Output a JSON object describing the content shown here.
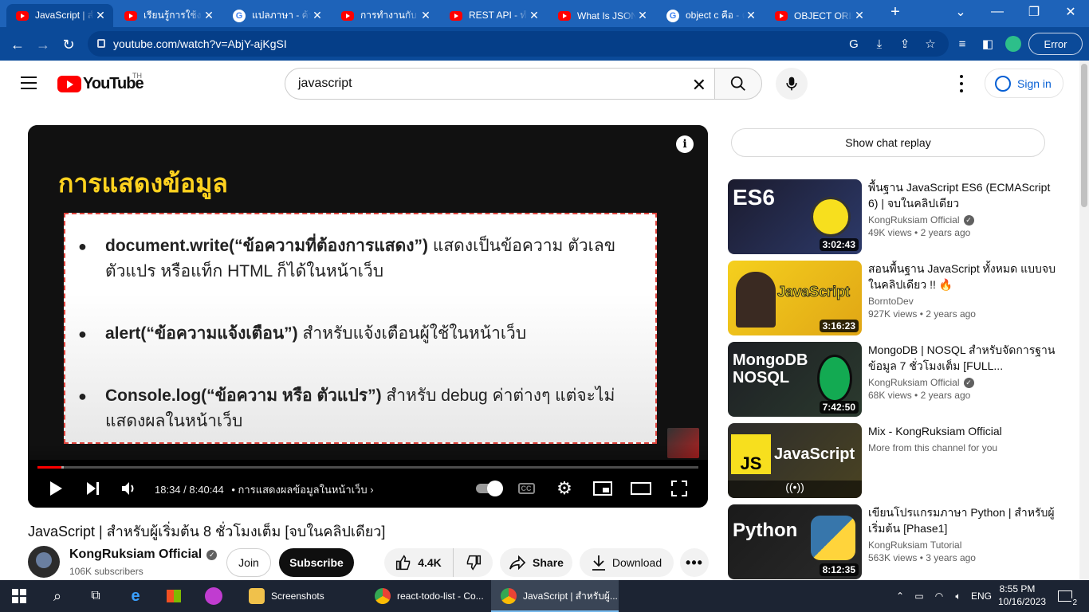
{
  "browser": {
    "tabs": [
      {
        "title": "JavaScript | สำหรับผู้เริ่มต้น",
        "favicon": "youtube-icon",
        "active": true
      },
      {
        "title": "เรียนรู้การใช้งาน",
        "favicon": "youtube-icon",
        "active": false
      },
      {
        "title": "แปลภาษา - ค้นหา",
        "favicon": "google-icon",
        "active": false
      },
      {
        "title": "การทำงานกับ JSON",
        "favicon": "youtube-icon",
        "active": false
      },
      {
        "title": "REST API - ทำ",
        "favicon": "youtube-icon",
        "active": false
      },
      {
        "title": "What Is JSON",
        "favicon": "youtube-icon",
        "active": false
      },
      {
        "title": "object c คือ - ค้นหา",
        "favicon": "google-icon",
        "active": false
      },
      {
        "title": "OBJECT ORIENTED",
        "favicon": "youtube-icon",
        "active": false
      }
    ],
    "new_tab": "+",
    "url": "youtube.com/watch?v=AbjY-ajKgSI",
    "error_button": "Error",
    "accent": "#1e63b9"
  },
  "youtube": {
    "logo_text": "YouTube",
    "country_code": "TH",
    "search_value": "javascript",
    "sign_in": "Sign in"
  },
  "player": {
    "slide_title": "การแสดงข้อมูล",
    "bullets": [
      {
        "code": "document.write(“ข้อความที่ต้องการแสดง”)",
        "text": " แสดงเป็นข้อความ ตัวเลข ตัวแปร หรือแท็ก HTML ก็ได้ในหน้าเว็บ"
      },
      {
        "code": "alert(“ข้อความแจ้งเตือน”)",
        "text": " สำหรับแจ้งเตือนผู้ใช้ในหน้าเว็บ"
      },
      {
        "code": "Console.log(“ข้อความ หรือ ตัวแปร”)",
        "text": " สำหรับ debug ค่าต่างๆ แต่จะไม่แสดงผลในหน้าเว็บ"
      }
    ],
    "current_time": "18:34",
    "duration": "8:40:44",
    "chapter": "• การแสดงผลข้อมูลในหน้าเว็บ",
    "progress_fraction": 0.0356,
    "buffered_fraction": 0.04
  },
  "video": {
    "title": "JavaScript | สำหรับผู้เริ่มต้น 8 ชั่วโมงเต็ม [จบในคลิปเดียว]",
    "channel": "KongRuksiam Official",
    "subscribers": "106K subscribers",
    "join": "Join",
    "subscribe": "Subscribe",
    "likes": "4.4K",
    "share": "Share",
    "download": "Download"
  },
  "sidebar": {
    "chat_replay": "Show chat replay",
    "recommendations": [
      {
        "title": "พื้นฐาน JavaScript ES6 (ECMAScript 6) | จบในคลิปเดียว",
        "channel": "KongRuksiam Official",
        "verified": true,
        "views": "49K views",
        "age": "• 2 years ago",
        "duration": "3:02:43",
        "thumb_text": "ES6",
        "thumb_color": "#1b1b2e"
      },
      {
        "title": "สอนพื้นฐาน JavaScript ทั้งหมด แบบจบในคลิปเดียว !! 🔥",
        "channel": "BorntoDev",
        "verified": false,
        "views": "927K views",
        "age": "• 2 years ago",
        "duration": "3:16:23",
        "thumb_text": "JavaScript",
        "thumb_color": "#f0c21b"
      },
      {
        "title": "MongoDB | NOSQL สำหรับจัดการฐานข้อมูล 7 ชั่วโมงเต็ม [FULL...",
        "channel": "KongRuksiam Official",
        "verified": true,
        "views": "68K views",
        "age": "• 2 years ago",
        "duration": "7:42:50",
        "thumb_text": "MongoDB NOSQL",
        "thumb_color": "#1d1f24"
      },
      {
        "title": "Mix - KongRuksiam Official",
        "channel": "More from this channel for you",
        "verified": false,
        "views": "",
        "age": "",
        "duration": "",
        "thumb_text": "JavaScript",
        "thumb_color": "#2c2c2c"
      },
      {
        "title": "เขียนโปรแกรมภาษา Python | สำหรับผู้เริ่มต้น [Phase1]",
        "channel": "KongRuksiam Tutorial",
        "verified": false,
        "views": "563K views",
        "age": "• 3 years ago",
        "duration": "8:12:35",
        "thumb_text": "Python",
        "thumb_color": "#1a1a1a"
      }
    ]
  },
  "taskbar": {
    "apps": [
      {
        "label": "Screenshots",
        "icon": "folder-icon",
        "active": false
      },
      {
        "label": "react-todo-list - Co...",
        "icon": "chrome-icon",
        "active": false
      },
      {
        "label": "JavaScript | สำหรับผู้...",
        "icon": "chrome-icon",
        "active": true
      }
    ],
    "language": "ENG",
    "time": "8:55 PM",
    "date": "10/16/2023",
    "notification_count": "2"
  }
}
